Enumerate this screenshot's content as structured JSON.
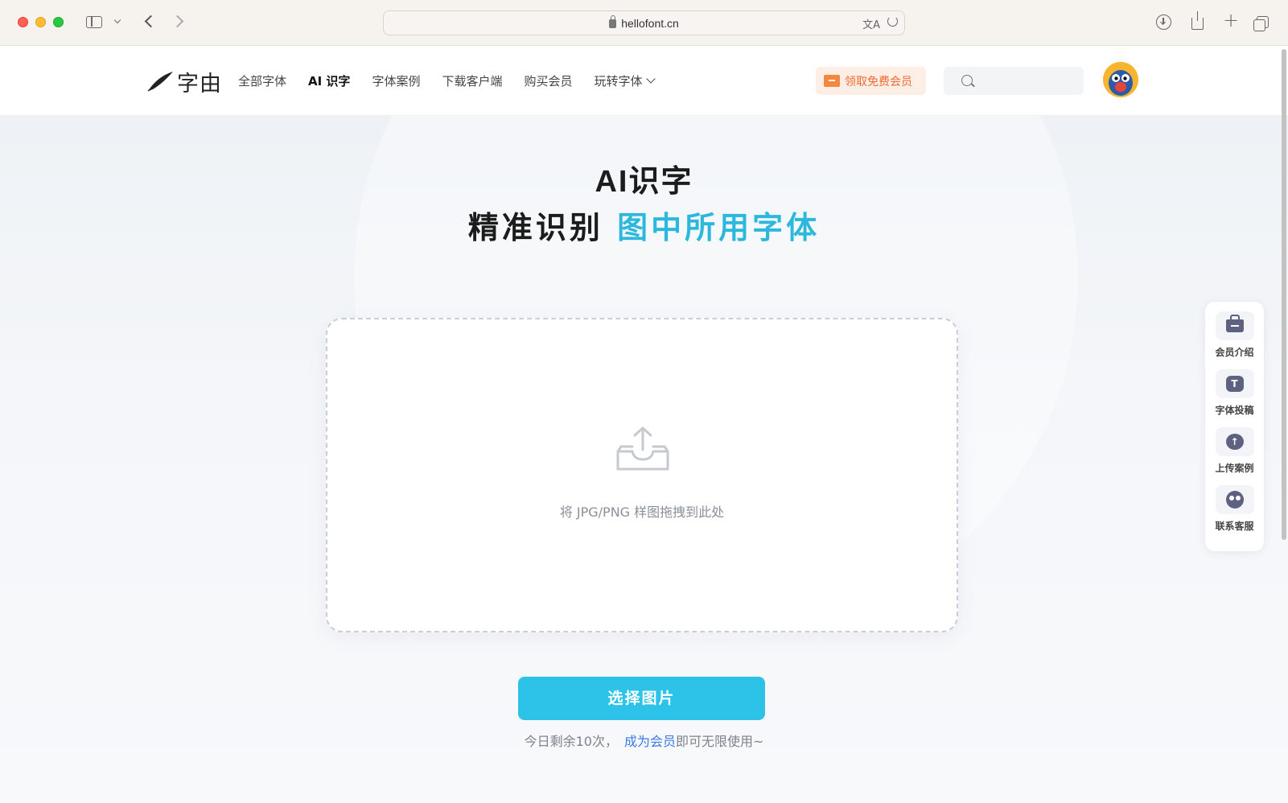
{
  "browser": {
    "url": "hellofont.cn",
    "icons": [
      "sidebar-toggle-icon",
      "chevron-down-icon",
      "back-arrow-icon",
      "forward-arrow-icon",
      "translate-icon",
      "reload-icon",
      "download-icon",
      "share-icon",
      "new-tab-icon",
      "tabs-overview-icon"
    ]
  },
  "header": {
    "logo_text": "字由",
    "nav": [
      "全部字体",
      "AI 识字",
      "字体案例",
      "下载客户端",
      "购买会员",
      "玩转字体"
    ],
    "active_nav": "AI 识字",
    "promo_label": "领取免费会员",
    "search_placeholder": ""
  },
  "hero": {
    "title": "AI识字",
    "subtitle_prefix": "精准识别",
    "subtitle_highlight": "图中所用字体",
    "drop_text": "将 JPG/PNG 样图拖拽到此处",
    "choose_button": "选择图片",
    "quota_prefix": "今日剩余10次，",
    "quota_link": "成为会员",
    "quota_suffix": "即可无限使用~"
  },
  "side_panel": {
    "items": [
      {
        "label": "会员介绍",
        "icon": "membership-icon"
      },
      {
        "label": "字体投稿",
        "icon": "font-submit-icon",
        "glyph": "T"
      },
      {
        "label": "上传案例",
        "icon": "upload-case-icon",
        "glyph": "↑"
      },
      {
        "label": "联系客服",
        "icon": "customer-service-icon"
      }
    ]
  },
  "colors": {
    "accent": "#2dc3e8",
    "highlight_text": "#2bb8dc",
    "promo": "#f06b32",
    "link": "#3c7ae8"
  }
}
